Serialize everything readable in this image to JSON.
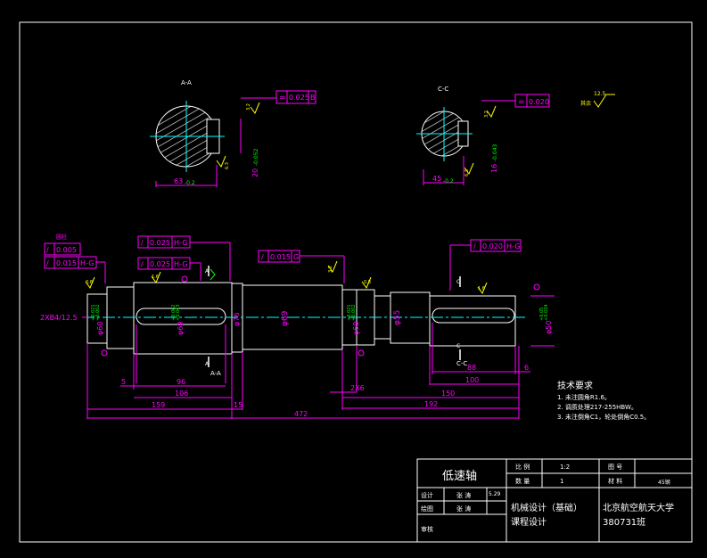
{
  "colors": {
    "background": "#000000",
    "outline": "#ffffff",
    "dimension": "#ff00ff",
    "centerline": "#00ffff",
    "tolerance": "#00ff00",
    "roughness": "#ffff00",
    "hatch": "#ffffff"
  },
  "sections": {
    "aa": {
      "label": "A-A",
      "tol_symbol": "=",
      "tol_value": "0.025",
      "tol_datum": "B",
      "width_dim": "63",
      "width_tol": "-0.2",
      "depth_dim": "20",
      "depth_tol": "-0.052",
      "rough1": "3.2",
      "rough2": "6.3"
    },
    "cc": {
      "label": "C-C",
      "tol_symbol": "=",
      "tol_value": "0.020",
      "width_dim": "45",
      "width_tol": "-0.2",
      "depth_dim": "16",
      "depth_tol": "-0.043",
      "rough1": "3.2",
      "rough2": "6.3"
    }
  },
  "roughness_other": {
    "value": "12.5",
    "label": "其余"
  },
  "shaft": {
    "center_mark": "2XB4/12.5",
    "label_a_top": "A",
    "label_a_bottom": "A",
    "section_label_a": "A-A",
    "label_c_top": "C",
    "label_c_bottom": "C",
    "section_label_c": "C-C",
    "gtol_left_title": "圆柱",
    "gtol_left1": "0.005",
    "gtol_left2_value": "0.015",
    "gtol_left2_datum": "H-G",
    "gtol_a1_value": "0.025",
    "gtol_a1_datum": "H-G",
    "gtol_a2_value": "0.025",
    "gtol_a2_datum": "H-G",
    "gtol_mid_value": "0.015",
    "gtol_mid_datum": "G",
    "gtol_right_value": "0.020",
    "gtol_right_datum": "H-G",
    "dia1": "φ60",
    "dia1_tol_up": "+0.021",
    "dia1_tol_lo": "+0.002",
    "dia2": "φ69",
    "dia2_tol_up": "+0.062",
    "dia2_tol_lo": "+0.043",
    "dia3": "φ76",
    "dia4": "φ69",
    "dia5": "φ60",
    "dia5_tol_up": "+0.021",
    "dia5_tol_lo": "+0.002",
    "dia6": "φ55",
    "dia7": "φ50",
    "dia7_tol_up": "+0.05",
    "dia7_tol_lo": "+0.034",
    "r_left": "0.8",
    "r_a": "1.6",
    "r_mid": "3.2",
    "r_right1": "0.8",
    "r_right2": "1.6",
    "r_shoulder": "3.2",
    "dim_5": "5",
    "dim_96": "96",
    "dim_106": "106",
    "dim_159": "159",
    "dim_15": "15",
    "dim_472": "472",
    "dim_2x6": "2X6",
    "dim_150": "150",
    "dim_192": "192",
    "dim_100": "100",
    "dim_88": "88",
    "dim_6": "6"
  },
  "notes": {
    "title": "技术要求",
    "items": [
      "1. 未注圆角R1.6。",
      "2. 调质处理217-255HBW。",
      "3. 未注倒角C1，轮处倒角C0.5。"
    ]
  },
  "title_block": {
    "part_name": "低速轴",
    "scale_label": "比 例",
    "scale_value": "1:2",
    "drawing_no_label": "图 号",
    "qty_label": "数 量",
    "qty_value": "1",
    "material_label": "材 料",
    "material_value": "45钢",
    "design_label": "设计",
    "design_name": "张 涛",
    "design_date": "5.29",
    "drawing_label": "绘图",
    "drawing_name": "张 涛",
    "review_label": "审核",
    "course_line1": "机械设计（基础）",
    "course_line2": "课程设计",
    "school": "北京航空航天大学",
    "class_no": "380731班"
  }
}
